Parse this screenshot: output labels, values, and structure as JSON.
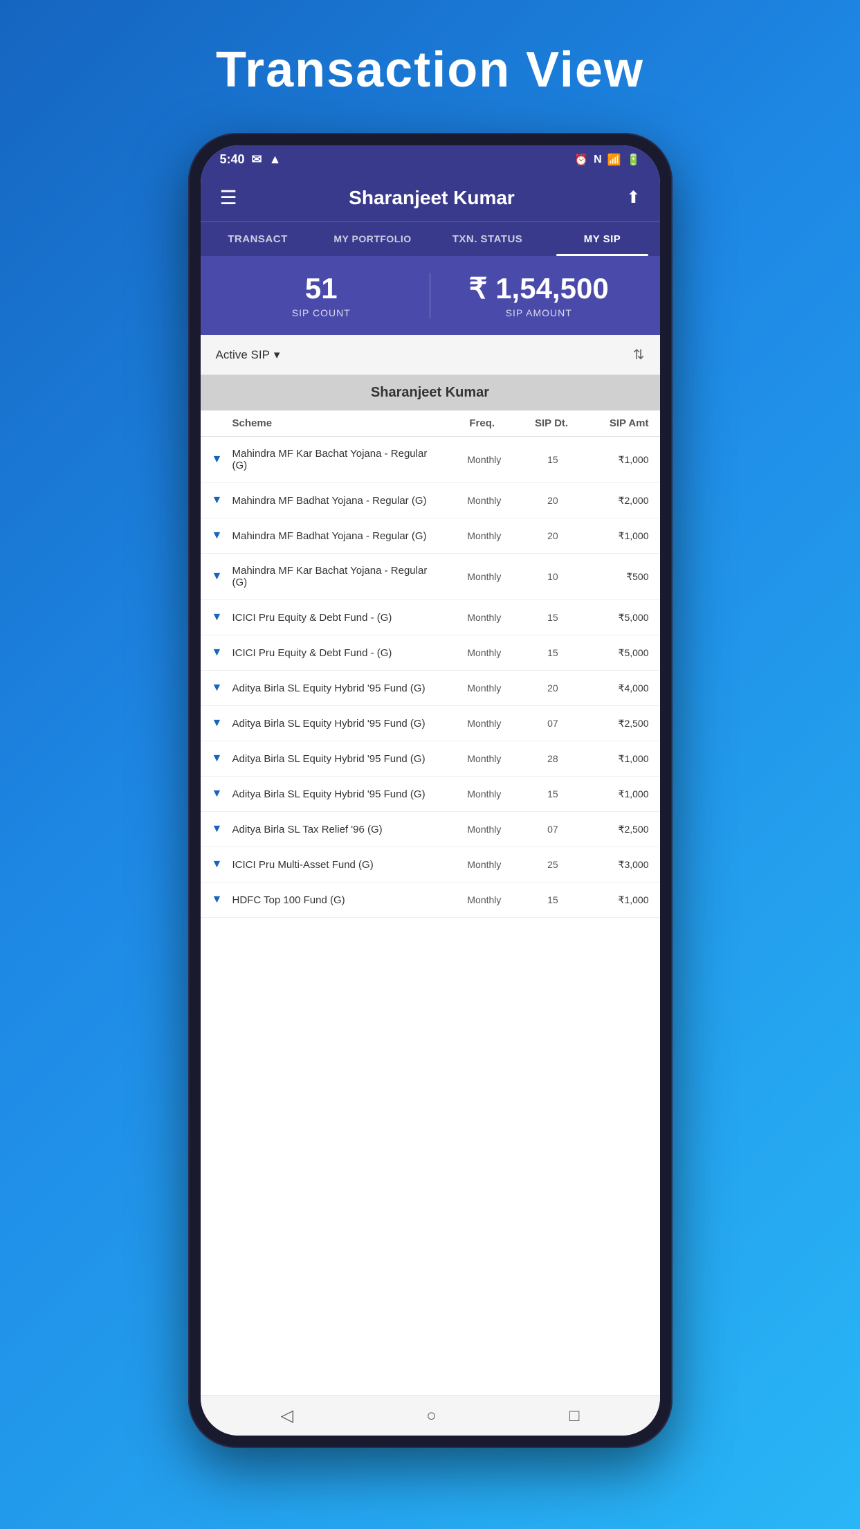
{
  "page": {
    "title": "Transaction View",
    "background": "#1565c0"
  },
  "statusBar": {
    "time": "5:40",
    "icons_left": [
      "gmail",
      "drive"
    ],
    "icons_right": [
      "alarm",
      "nfc",
      "signal",
      "battery"
    ]
  },
  "header": {
    "title": "Sharanjeet Kumar",
    "menu_icon": "☰",
    "share_icon": "⬆"
  },
  "navTabs": [
    {
      "id": "transact",
      "label": "TRANSACT",
      "active": false
    },
    {
      "id": "my-portfolio",
      "label": "MY PORTFOLIO",
      "active": false
    },
    {
      "id": "txn-status",
      "label": "TXN. STATUS",
      "active": false
    },
    {
      "id": "my-sip",
      "label": "MY SIP",
      "active": true
    }
  ],
  "sipSummary": {
    "count": {
      "value": "51",
      "label": "SIP COUNT"
    },
    "amount": {
      "value": "₹ 1,54,500",
      "label": "SIP AMOUNT"
    }
  },
  "filterBar": {
    "label": "Active SIP",
    "dropdown_icon": "▾",
    "sort_icon": "⇅"
  },
  "holderName": "Sharanjeet Kumar",
  "tableHeaders": {
    "scheme": "Scheme",
    "freq": "Freq.",
    "sipDt": "SIP Dt.",
    "sipAmt": "SIP Amt"
  },
  "sipRows": [
    {
      "scheme": "Mahindra MF Kar Bachat Yojana - Regular (G)",
      "freq": "Monthly",
      "dt": "15",
      "amt": "₹1,000"
    },
    {
      "scheme": "Mahindra MF Badhat Yojana - Regular (G)",
      "freq": "Monthly",
      "dt": "20",
      "amt": "₹2,000"
    },
    {
      "scheme": "Mahindra MF Badhat Yojana - Regular (G)",
      "freq": "Monthly",
      "dt": "20",
      "amt": "₹1,000"
    },
    {
      "scheme": "Mahindra MF Kar Bachat Yojana - Regular (G)",
      "freq": "Monthly",
      "dt": "10",
      "amt": "₹500"
    },
    {
      "scheme": "ICICI Pru Equity & Debt Fund - (G)",
      "freq": "Monthly",
      "dt": "15",
      "amt": "₹5,000"
    },
    {
      "scheme": "ICICI Pru Equity & Debt Fund - (G)",
      "freq": "Monthly",
      "dt": "15",
      "amt": "₹5,000"
    },
    {
      "scheme": "Aditya Birla SL Equity Hybrid '95 Fund (G)",
      "freq": "Monthly",
      "dt": "20",
      "amt": "₹4,000"
    },
    {
      "scheme": "Aditya Birla SL Equity Hybrid '95 Fund (G)",
      "freq": "Monthly",
      "dt": "07",
      "amt": "₹2,500"
    },
    {
      "scheme": "Aditya Birla SL Equity Hybrid '95 Fund (G)",
      "freq": "Monthly",
      "dt": "28",
      "amt": "₹1,000"
    },
    {
      "scheme": "Aditya Birla SL Equity Hybrid '95 Fund (G)",
      "freq": "Monthly",
      "dt": "15",
      "amt": "₹1,000"
    },
    {
      "scheme": "Aditya Birla SL Tax Relief '96 (G)",
      "freq": "Monthly",
      "dt": "07",
      "amt": "₹2,500"
    },
    {
      "scheme": "ICICI Pru Multi-Asset Fund (G)",
      "freq": "Monthly",
      "dt": "25",
      "amt": "₹3,000"
    },
    {
      "scheme": "HDFC Top 100 Fund (G)",
      "freq": "Monthly",
      "dt": "15",
      "amt": "₹1,000"
    }
  ],
  "bottomNav": {
    "back": "◁",
    "home": "○",
    "recent": "□"
  }
}
